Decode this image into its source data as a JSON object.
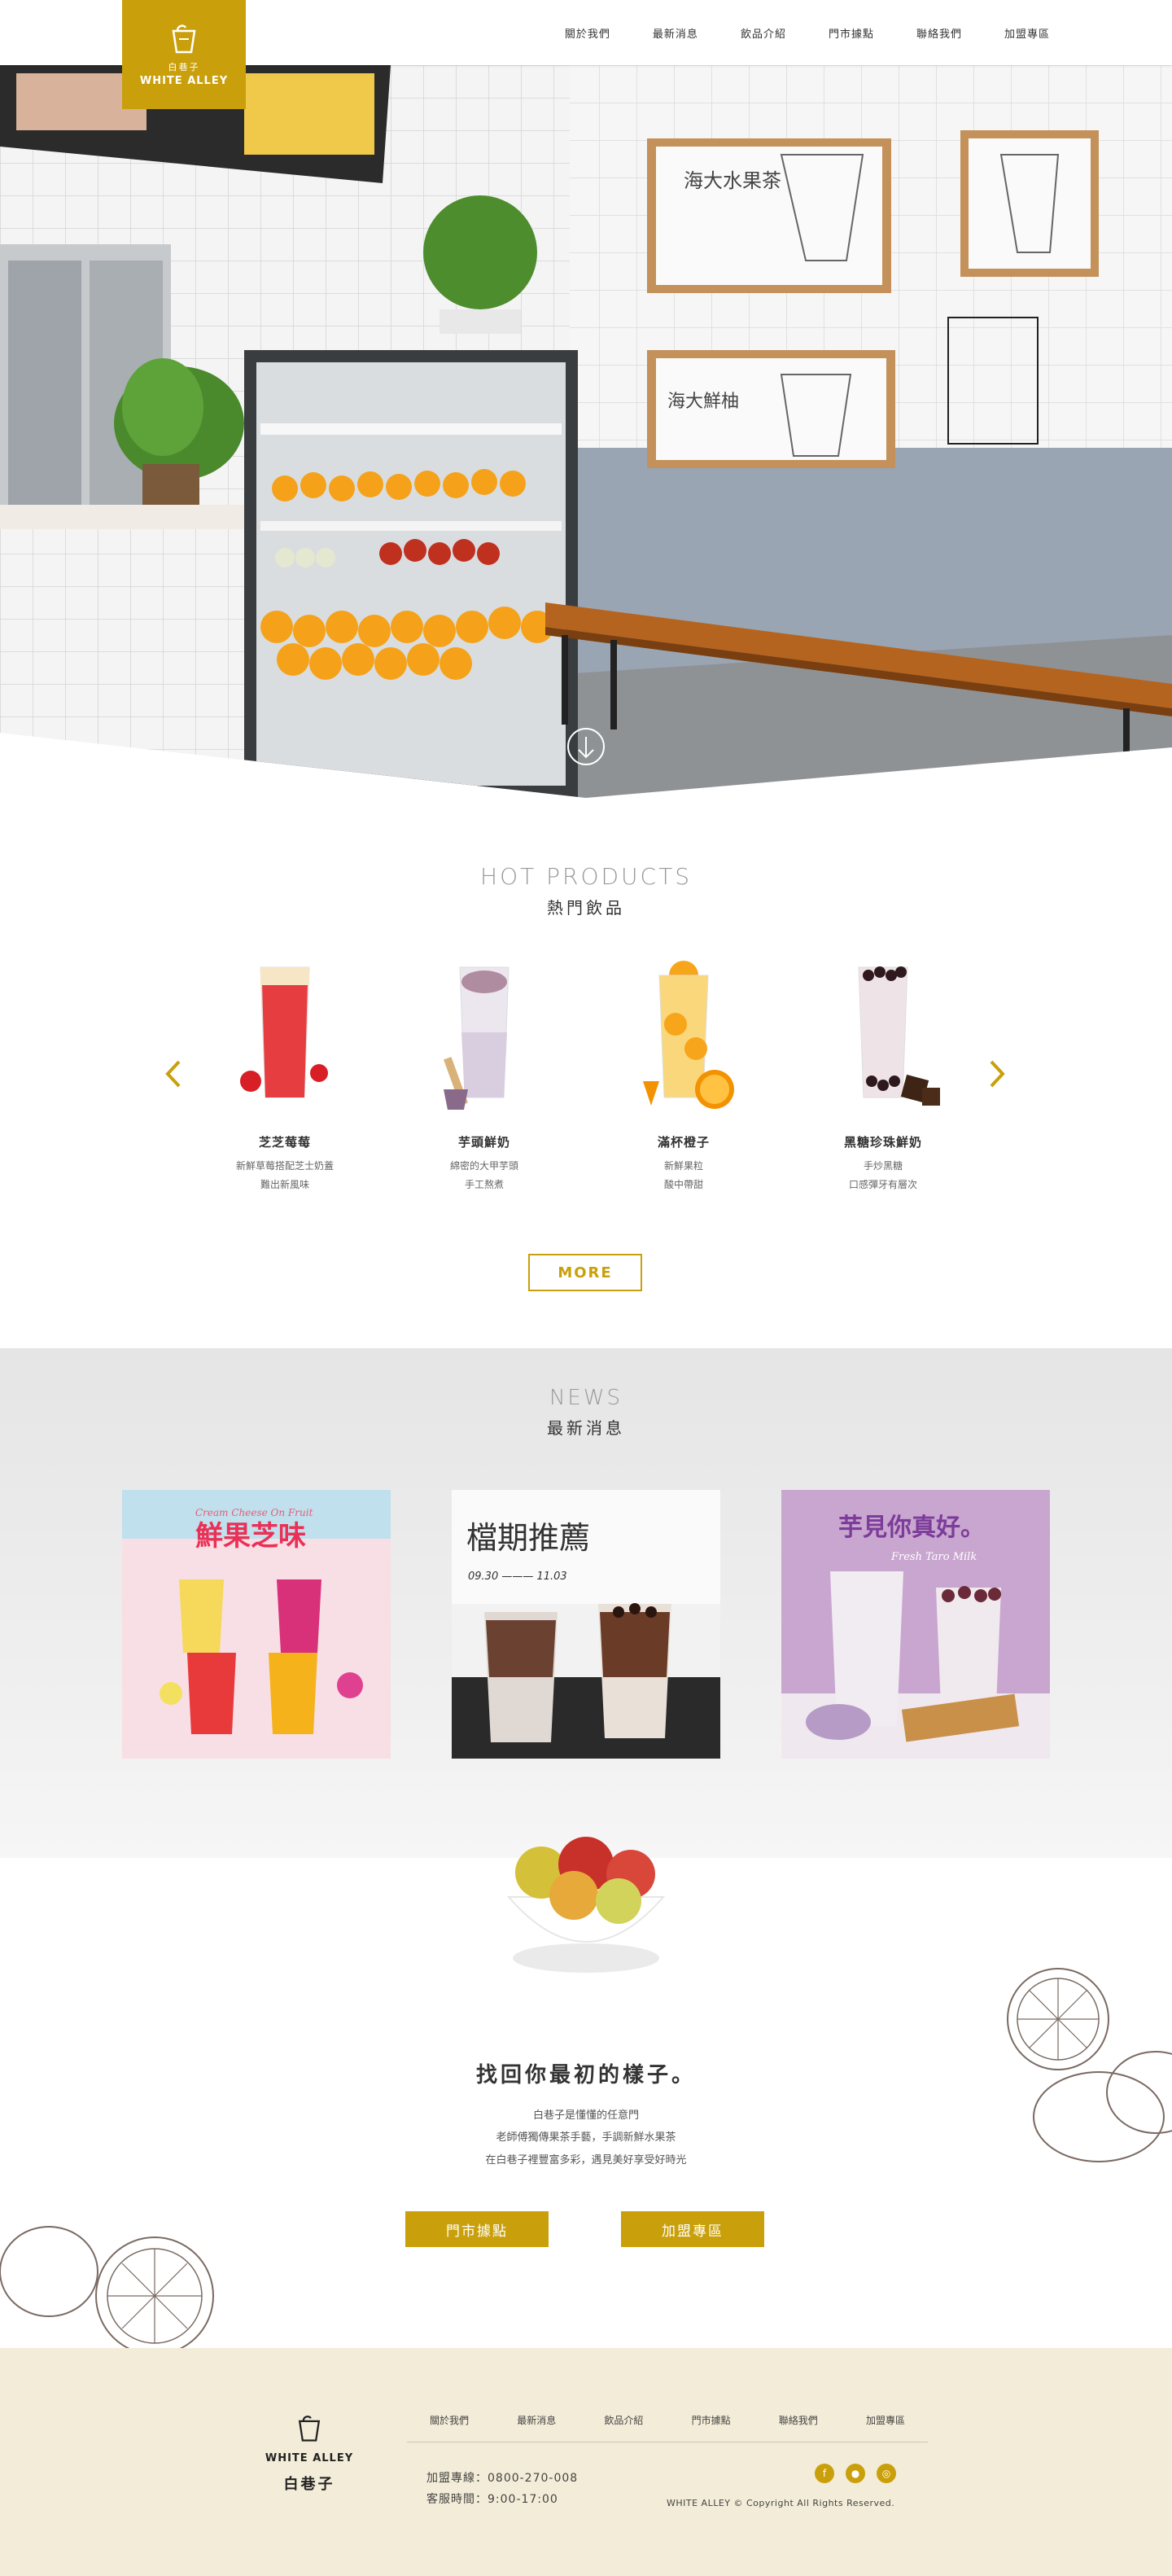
{
  "brand": {
    "logo_cn": "白巷子",
    "logo_en": "WHITE ALLEY",
    "accent": "#c9a00b"
  },
  "nav": {
    "items": [
      "關於我們",
      "最新消息",
      "飲品介紹",
      "門市據點",
      "聯絡我們",
      "加盟專區"
    ]
  },
  "hero": {
    "sign_1": "海大水果茶",
    "sign_2": "海大鮮柚",
    "scroll_icon": "arrow-down-circle-icon"
  },
  "hot_products": {
    "title_en": "HOT PRODUCTS",
    "title_cn": "熱門飲品",
    "prev_icon": "chevron-left-icon",
    "next_icon": "chevron-right-icon",
    "items": [
      {
        "name": "芝芝莓莓",
        "desc_1": "新鮮草莓搭配芝士奶蓋",
        "desc_2": "難出新風味"
      },
      {
        "name": "芋頭鮮奶",
        "desc_1": "綿密的大甲芋頭",
        "desc_2": "手工熬煮"
      },
      {
        "name": "滿杯橙子",
        "desc_1": "新鮮果粒",
        "desc_2": "酸中帶甜"
      },
      {
        "name": "黑糖珍珠鮮奶",
        "desc_1": "手炒黑糖",
        "desc_2": "口感彈牙有層次"
      }
    ],
    "more_label": "MORE"
  },
  "news": {
    "title_en": "NEWS",
    "title_cn": "最新消息",
    "cards": [
      {
        "headline": "鮮果芝味",
        "script": "Cream Cheese On Fruit"
      },
      {
        "headline": "檔期推薦",
        "date": "09.30 ——— 11.03"
      },
      {
        "headline": "芋見你真好。",
        "script": "Fresh Taro Milk"
      }
    ]
  },
  "slogan": {
    "title": "找回你最初的樣子。",
    "line_1": "白巷子是懂懂的任意門",
    "line_2": "老師傅獨傳果茶手藝，手調新鮮水果茶",
    "line_3": "在白巷子裡豐富多彩，遇見美好享受好時光",
    "cta_1": "門市據點",
    "cta_2": "加盟專區"
  },
  "footer": {
    "logo_en": "WHITE ALLEY",
    "logo_cn": "白巷子",
    "nav": [
      "關於我們",
      "最新消息",
      "飲品介紹",
      "門市據點",
      "聯絡我們",
      "加盟專區"
    ],
    "phone": "加盟專線：0800-270-008",
    "hours": "客服時間：9:00-17:00",
    "copyright": "WHITE ALLEY © Copyright All Rights Reserved.",
    "social": [
      "facebook-icon",
      "line-icon",
      "instagram-icon"
    ]
  }
}
